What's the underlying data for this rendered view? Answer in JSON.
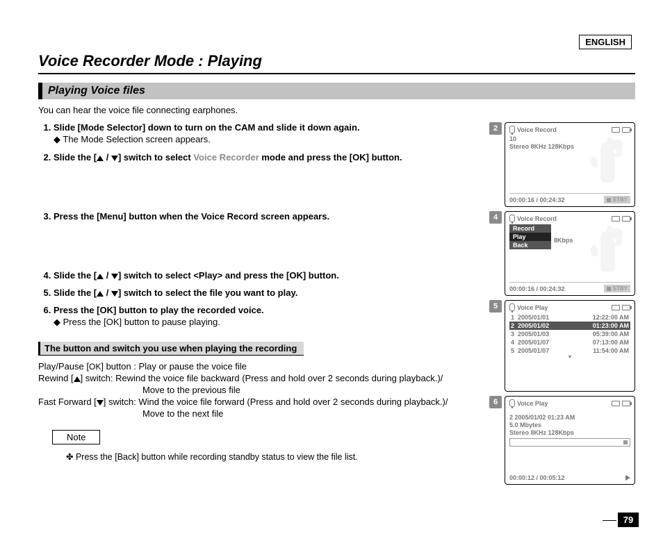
{
  "language_label": "ENGLISH",
  "page_title": "Voice Recorder Mode : Playing",
  "section_title": "Playing Voice files",
  "intro_text": "You can hear the voice file connecting earphones.",
  "steps": {
    "s1": "Slide [Mode Selector] down to turn on the CAM and slide it down again.",
    "s1_sub": "◆ The Mode Selection screen appears.",
    "s2_a": "Slide the [",
    "s2_b": "] switch to select ",
    "s2_mode": "Voice Recorder",
    "s2_c": " mode and press the [OK] button.",
    "s3": "Press the [Menu] button when the Voice Record screen appears.",
    "s4_a": "Slide the [",
    "s4_b": "] switch to select <Play> and press the [OK] button.",
    "s5_a": "Slide the [",
    "s5_b": "] switch to select the file you want to play.",
    "s6": "Press the [OK] button to play the recorded voice.",
    "s6_sub": "◆ Press the [OK] button to pause playing."
  },
  "controls_header": "The button and switch you use when playing the recording",
  "controls": {
    "play_pause": "Play/Pause [",
    "play_pause_b": "] button : Play or pause the voice file",
    "ok_text": "OK",
    "rewind_a": "Rewind [",
    "rewind_b": "] switch: Rewind the voice file backward (Press and hold over 2 seconds during playback.)/",
    "rewind_c": "Move to the previous file",
    "ff_a": "Fast Forward [",
    "ff_b": "] switch: Wind the voice file forward (Press and hold over 2 seconds during playback.)/",
    "ff_c": "Move to the next file"
  },
  "note_label": "Note",
  "note_text": "✤  Press the [Back] button while recording standby status to view the file list.",
  "page_number": "79",
  "screens": {
    "s2": {
      "tag": "2",
      "title": "Voice Record",
      "line1": "10",
      "line2": "Stereo  8KHz  128Kbps",
      "time": "00:00:16 / 00:24:32",
      "badge": "STBY"
    },
    "s4": {
      "tag": "4",
      "title": "Voice Record",
      "menu": {
        "m1": "Record",
        "m2": "Play",
        "m3": "Back"
      },
      "behind": "8Kbps",
      "time": "00:00:16 / 00:24:32",
      "badge": "STBY"
    },
    "s5": {
      "tag": "5",
      "title": "Voice Play",
      "rows": [
        {
          "n": "1",
          "d": "2005/01/01",
          "t": "12:22:00 AM"
        },
        {
          "n": "2",
          "d": "2005/01/02",
          "t": "01:23:00 AM"
        },
        {
          "n": "3",
          "d": "2005/01/03",
          "t": "05:39:00 AM"
        },
        {
          "n": "4",
          "d": "2005/01/07",
          "t": "07:13:00 AM"
        },
        {
          "n": "5",
          "d": "2005/01/07",
          "t": "11:54:00 AM"
        }
      ]
    },
    "s6": {
      "tag": "6",
      "title": "Voice Play",
      "line1": "2  2005/01/02  01:23 AM",
      "line2": "5.0 Mbytes",
      "line3": "Stereo  8KHz  128Kbps",
      "time": "00:00:12 / 00:05:12"
    }
  }
}
